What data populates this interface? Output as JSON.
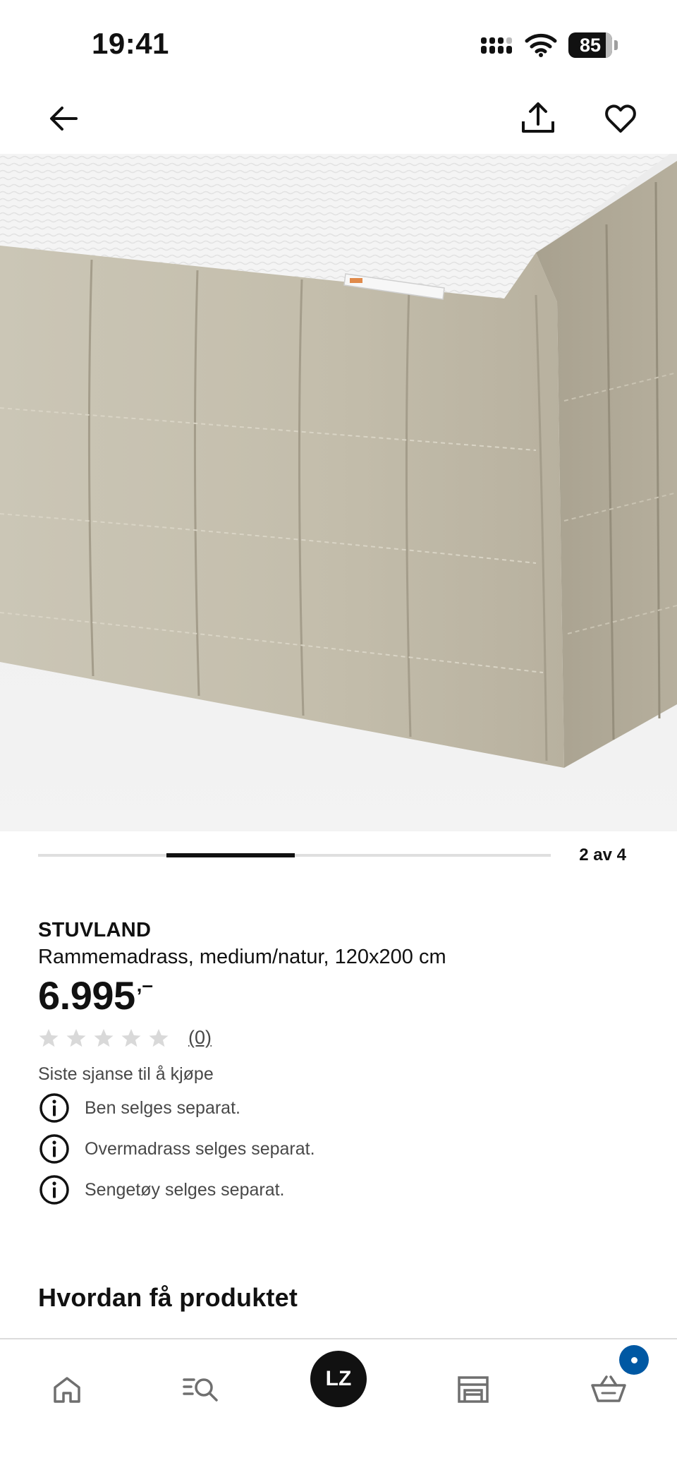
{
  "status_bar": {
    "time": "19:41",
    "battery": "85"
  },
  "header": {
    "back_icon": "arrow-left-icon",
    "share_icon": "share-icon",
    "favorite_icon": "heart-icon"
  },
  "gallery": {
    "image_alt": "STUVLAND Rammemadrass",
    "counter": "2 av 4",
    "current": 2,
    "total": 4
  },
  "product": {
    "brand": "STUVLAND",
    "description": "Rammemadrass, medium/natur, 120x200 cm",
    "price_integer": "6.995",
    "price_decimal": ",–",
    "rating_stars": 0,
    "review_count": "(0)",
    "availability": "Siste sjanse til å kjøpe",
    "notes": [
      "Ben selges separat.",
      "Overmadrass selges separat.",
      "Sengetøy selges separat."
    ]
  },
  "sections": {
    "how_to_get": "Hvordan få produktet"
  },
  "tabbar": {
    "items": [
      "home-icon",
      "search-list-icon",
      "profile-avatar",
      "store-icon",
      "basket-icon"
    ],
    "avatar_initials": "LZ",
    "badge_color": "#0058a3"
  },
  "colors": {
    "text": "#111111",
    "muted_text": "#484848",
    "star_empty": "#d9d9d9",
    "accent_blue": "#0058a3"
  }
}
